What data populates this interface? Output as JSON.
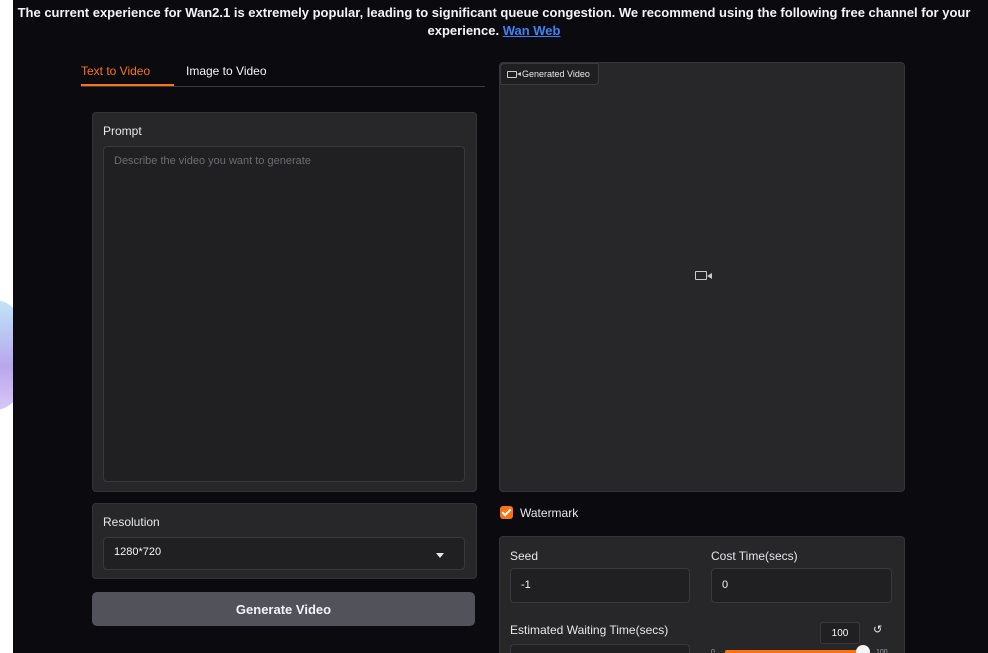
{
  "banner": {
    "text": "The current experience for Wan2.1 is extremely popular, leading to significant queue congestion. We recommend using the following free channel for your experience.",
    "link_label": "Wan Web"
  },
  "tabs": [
    {
      "label": "Text to Video",
      "active": true
    },
    {
      "label": "Image to Video",
      "active": false
    }
  ],
  "prompt": {
    "label": "Prompt",
    "placeholder": "Describe the video you want to generate"
  },
  "resolution": {
    "label": "Resolution",
    "value": "1280*720"
  },
  "generate_button": "Generate Video",
  "video": {
    "tag_label": "Generated Video"
  },
  "watermark": {
    "label": "Watermark",
    "checked": true
  },
  "settings": {
    "seed_label": "Seed",
    "seed_value": "-1",
    "cost_label": "Cost Time(secs)",
    "cost_value": "0",
    "wait_label": "Estimated Waiting Time(secs)",
    "wait_number": "100",
    "slider_min": "0",
    "slider_max": "100",
    "reset_icon": "↺"
  },
  "colors": {
    "accent": "#f97316",
    "background": "#0b0b0f",
    "panel": "#27272a",
    "link": "#3b82f6"
  }
}
